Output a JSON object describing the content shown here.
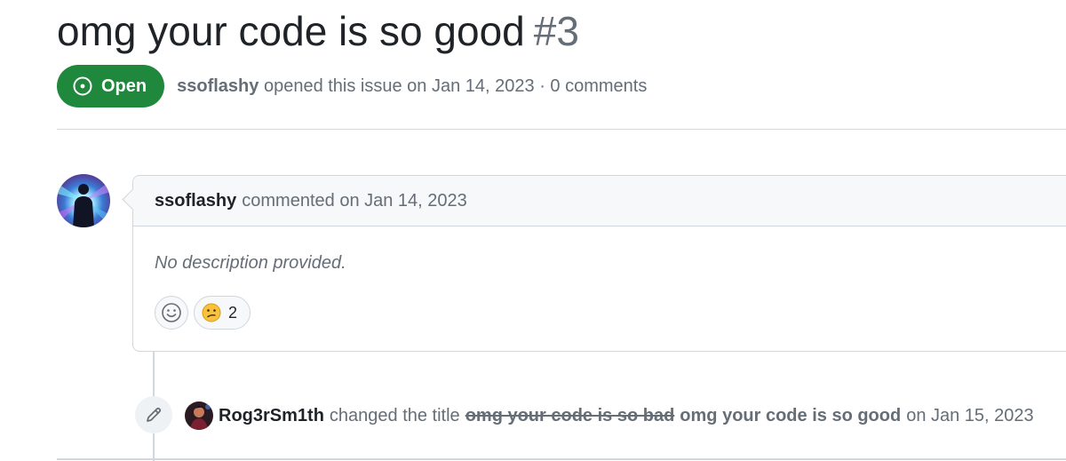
{
  "issue": {
    "title": "omg your code is so good",
    "number": "#3",
    "state": "Open",
    "author": "ssoflashy",
    "opened_text": "opened this issue on Jan 14, 2023 · 0 comments"
  },
  "comment": {
    "author": "ssoflashy",
    "commented_text": "commented on Jan 14, 2023",
    "body": "No description provided.",
    "reaction_confused_count": "2"
  },
  "event": {
    "actor": "Rog3rSm1th",
    "action": "changed the title",
    "old_title": "omg your code is so bad",
    "new_title": "omg your code is so good",
    "date_text": "on Jan 15, 2023"
  },
  "colors": {
    "open_green": "#1f883d",
    "border": "#d0d7de",
    "muted_text": "#656d76"
  },
  "icons": {
    "state": "issue-opened-icon",
    "add_reaction": "smiley-icon",
    "confused": "confused-emoji-icon",
    "timeline": "pencil-icon"
  }
}
